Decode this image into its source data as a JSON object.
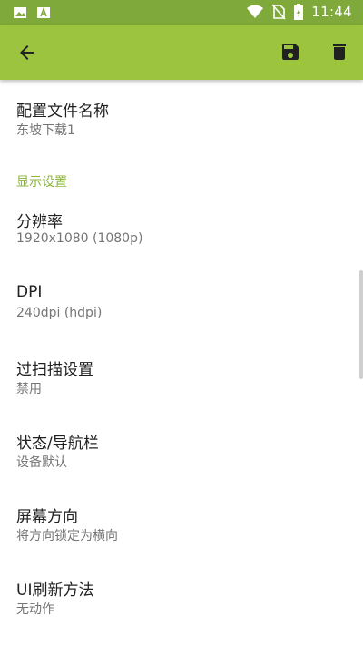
{
  "status_bar": {
    "time": "11:44",
    "left_icons": [
      "image-icon",
      "font-icon"
    ],
    "right_icons": [
      "wifi-icon",
      "no-sim-icon",
      "battery-icon"
    ]
  },
  "toolbar": {
    "back_icon": "arrow-left-icon",
    "save_icon": "save-icon",
    "delete_icon": "trash-icon",
    "color": "#9cc43f",
    "status_color": "#7fa93a"
  },
  "profile": {
    "title": "配置文件名称",
    "summary": "东坡下载1"
  },
  "display_category": "显示设置",
  "settings": [
    {
      "title": "分辨率",
      "summary": "1920x1080 (1080p)"
    },
    {
      "title": "DPI",
      "summary": "240dpi (hdpi)"
    },
    {
      "title": "过扫描设置",
      "summary": "禁用"
    },
    {
      "title": "状态/导航栏",
      "summary": "设备默认"
    },
    {
      "title": "屏幕方向",
      "summary": "将方向锁定为横向"
    },
    {
      "title": "UI刷新方法",
      "summary": "无动作"
    }
  ]
}
